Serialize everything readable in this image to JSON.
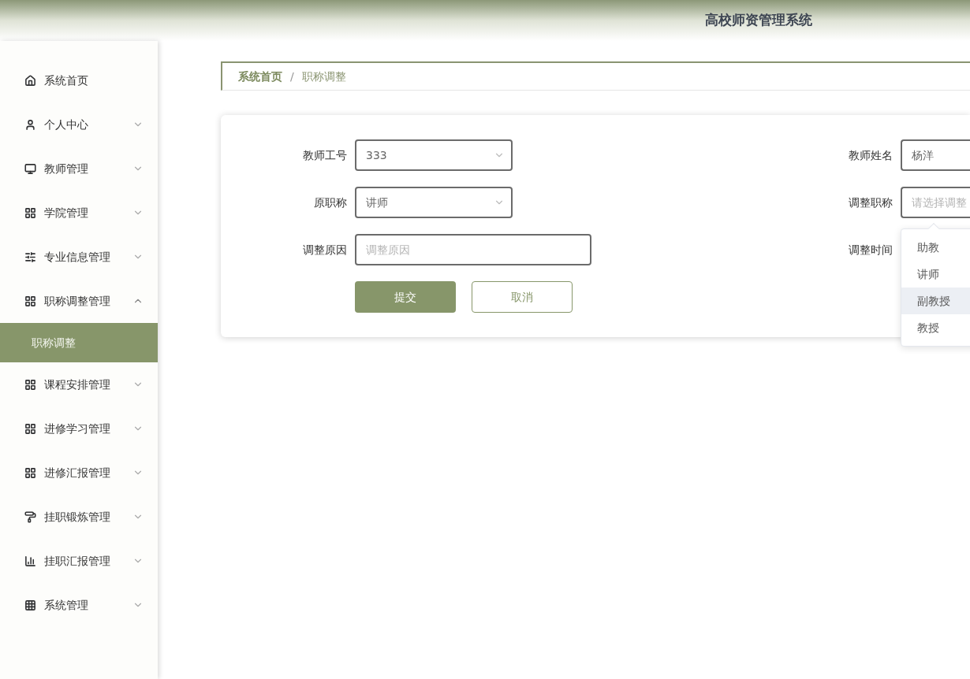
{
  "header": {
    "title": "高校师资管理系统"
  },
  "sidebar": {
    "items": [
      {
        "label": "系统首页",
        "expandable": false
      },
      {
        "label": "个人中心",
        "expandable": true,
        "expanded": false
      },
      {
        "label": "教师管理",
        "expandable": true,
        "expanded": false
      },
      {
        "label": "学院管理",
        "expandable": true,
        "expanded": false
      },
      {
        "label": "专业信息管理",
        "expandable": true,
        "expanded": false
      },
      {
        "label": "职称调整管理",
        "expandable": true,
        "expanded": true,
        "children": [
          {
            "label": "职称调整",
            "selected": true
          }
        ]
      },
      {
        "label": "课程安排管理",
        "expandable": true,
        "expanded": false
      },
      {
        "label": "进修学习管理",
        "expandable": true,
        "expanded": false
      },
      {
        "label": "进修汇报管理",
        "expandable": true,
        "expanded": false
      },
      {
        "label": "挂职锻炼管理",
        "expandable": true,
        "expanded": false
      },
      {
        "label": "挂职汇报管理",
        "expandable": true,
        "expanded": false
      },
      {
        "label": "系统管理",
        "expandable": true,
        "expanded": false
      }
    ]
  },
  "breadcrumb": [
    {
      "label": "系统首页",
      "current": false
    },
    {
      "label": "职称调整",
      "current": true
    }
  ],
  "breadcrumb_separator": "/",
  "form": {
    "left": [
      {
        "label": "教师工号",
        "kind": "select",
        "value": "333"
      },
      {
        "label": "原职称",
        "kind": "select",
        "value": "讲师"
      },
      {
        "label": "调整原因",
        "kind": "text",
        "placeholder": "调整原因"
      }
    ],
    "right": [
      {
        "label": "教师姓名",
        "value": "杨洋"
      },
      {
        "label": "调整职称",
        "placeholder": "请选择调整",
        "open": true,
        "options": [
          {
            "label": "助教",
            "highlighted": false
          },
          {
            "label": "讲师",
            "highlighted": false
          },
          {
            "label": "副教授",
            "highlighted": true
          },
          {
            "label": "教授",
            "highlighted": false
          }
        ]
      },
      {
        "label": "调整时间"
      }
    ],
    "buttons": [
      {
        "label": "提交",
        "kind": "primary"
      },
      {
        "label": "取消",
        "kind": "secondary"
      }
    ]
  }
}
